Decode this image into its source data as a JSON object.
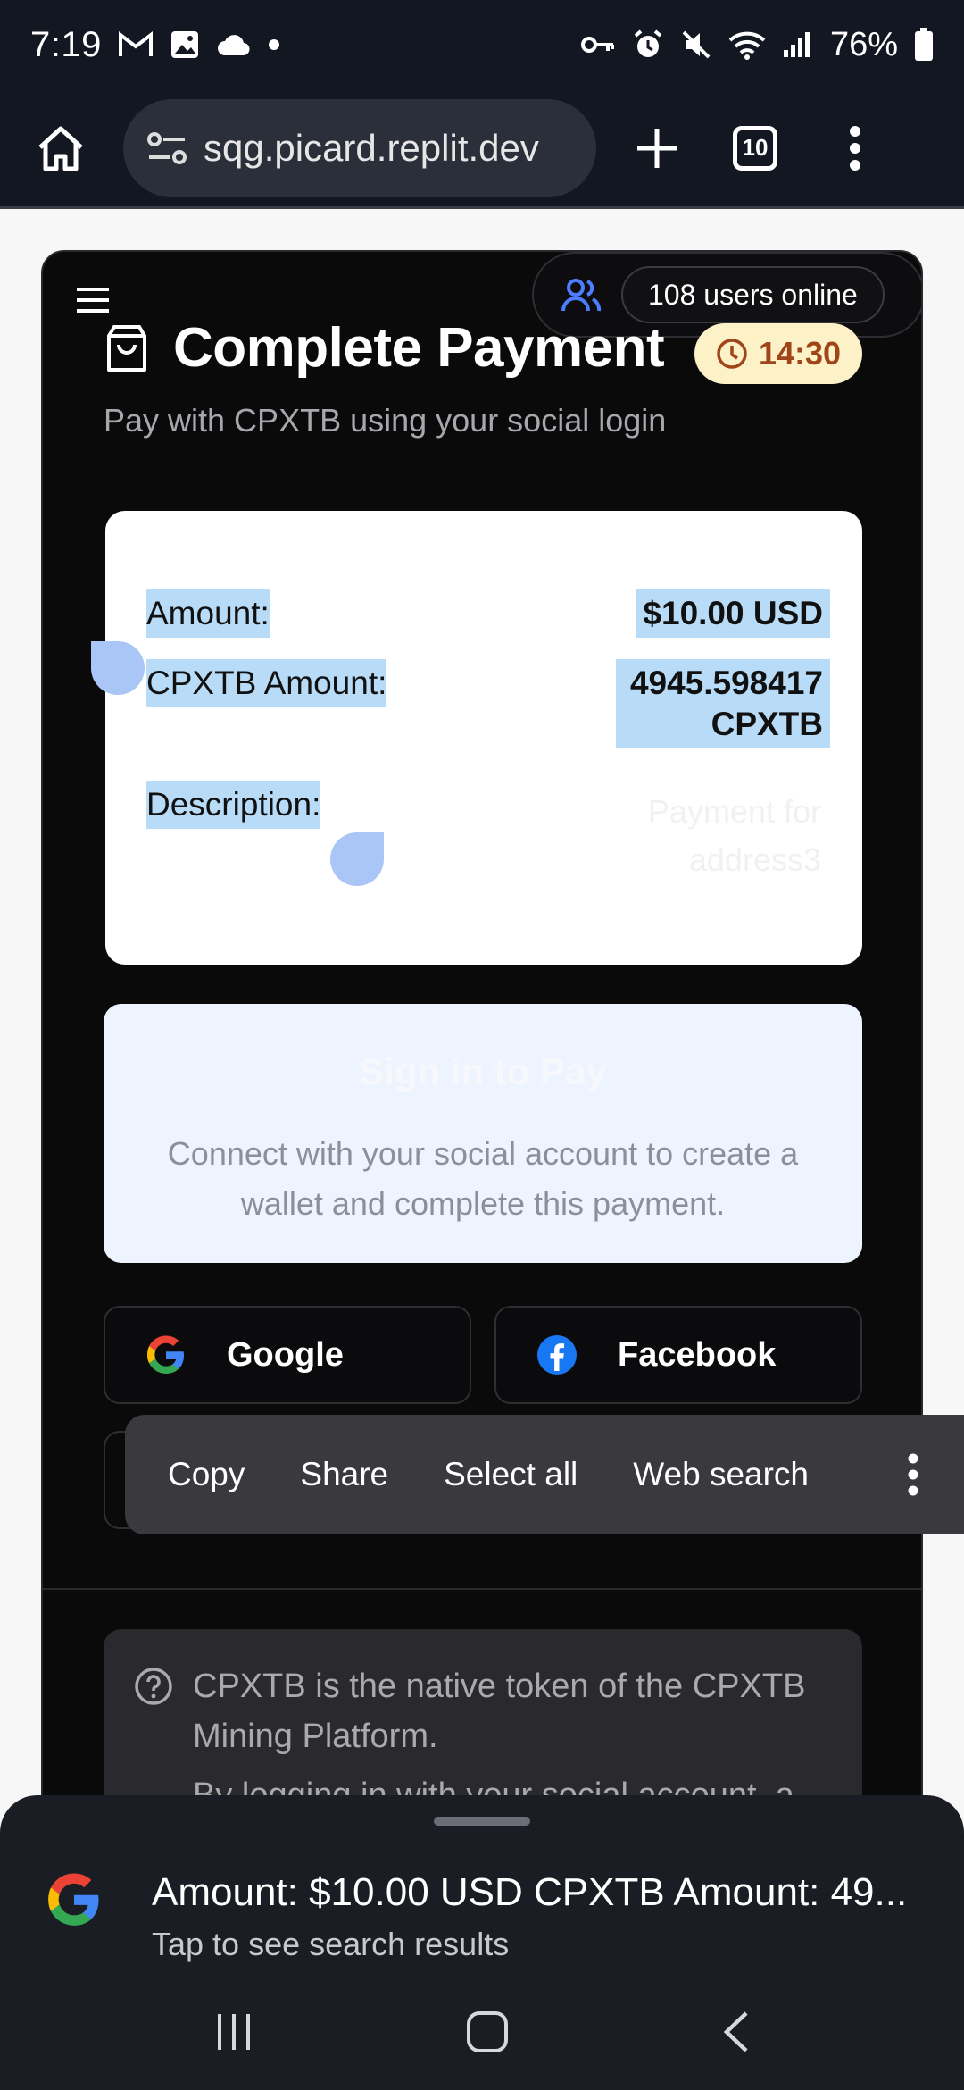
{
  "status_bar": {
    "time": "7:19",
    "battery": "76%"
  },
  "browser": {
    "url": "sqg.picard.replit.dev",
    "tab_count": "10"
  },
  "page": {
    "users_online": "108 users online",
    "title": "Complete Payment",
    "timer": "14:30",
    "subtitle": "Pay with CPXTB using your social login",
    "details": {
      "amount_label": "Amount:",
      "amount_value": "$10.00 USD",
      "cpxtb_label": "CPXTB Amount:",
      "cpxtb_value_line1": "4945.598417",
      "cpxtb_value_line2": "CPXTB",
      "description_label": "Description:",
      "description_value_line1": "Payment for",
      "description_value_line2": "address3"
    },
    "signin": {
      "title": "Sign in to Pay",
      "text": "Connect with your social account to create a wallet and complete this payment."
    },
    "social": {
      "google": "Google",
      "facebook": "Facebook"
    },
    "info": {
      "line1": "CPXTB is the native token of the CPXTB Mining Platform.",
      "line2": "By logging in with your social account, a"
    }
  },
  "context_menu": {
    "copy": "Copy",
    "share": "Share",
    "select_all": "Select all",
    "web_search": "Web search"
  },
  "search_sheet": {
    "title": "Amount: $10.00 USD CPXTB Amount: 49...",
    "subtitle": "Tap to see search results"
  },
  "colors": {
    "selection": "#b8dcf7",
    "timer_bg": "#fdf1c7",
    "timer_text": "#a0451a",
    "signin_bg": "#eef4ff"
  }
}
